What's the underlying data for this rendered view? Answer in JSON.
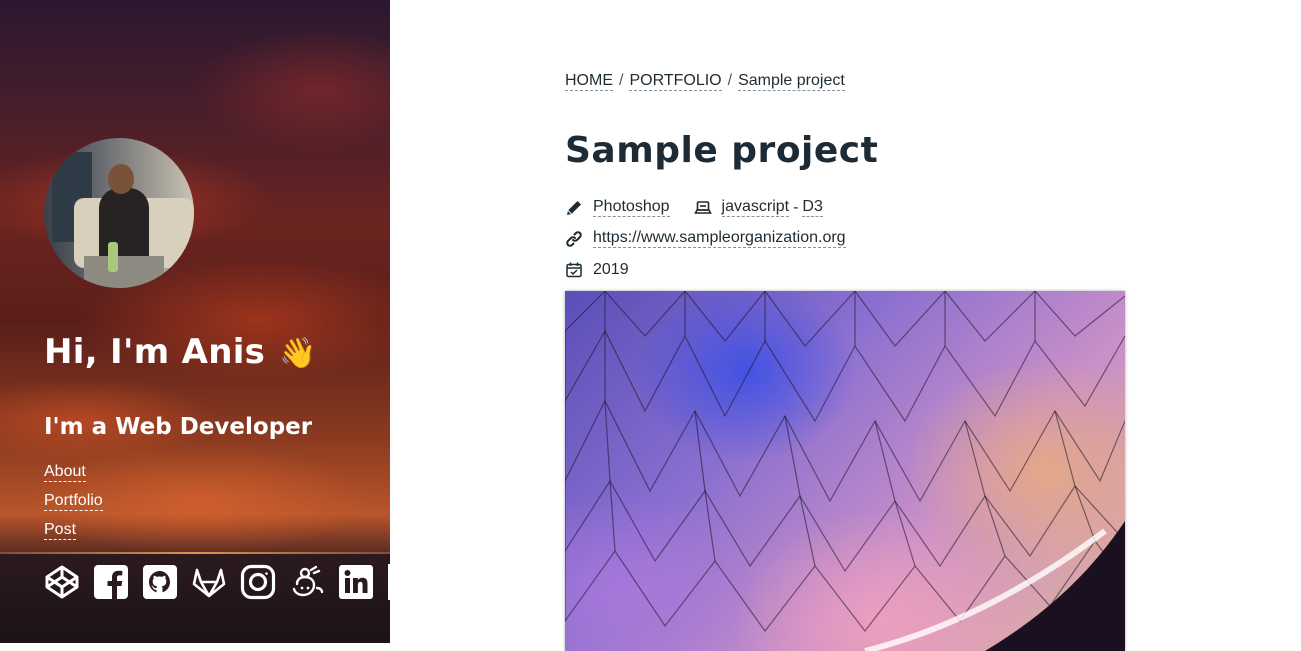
{
  "sidebar": {
    "greeting": "Hi, I'm Anis",
    "wave_emoji": "👋",
    "role": "I'm a Web Developer",
    "nav": [
      {
        "label": "About"
      },
      {
        "label": "Portfolio"
      },
      {
        "label": "Post"
      }
    ],
    "social": [
      "codepen-icon",
      "facebook-icon",
      "github-icon",
      "gitlab-icon",
      "instagram-icon",
      "keybase-icon",
      "linkedin-icon"
    ]
  },
  "breadcrumb": {
    "items": [
      {
        "label": "HOME"
      },
      {
        "label": "PORTFOLIO"
      },
      {
        "label": "Sample project"
      }
    ],
    "separator": "/"
  },
  "project": {
    "title": "Sample project",
    "tool": "Photoshop",
    "tech_1": "javascript",
    "tech_sep": "-",
    "tech_2": "D3",
    "url": "https://www.sampleorganization.org",
    "year": "2019"
  },
  "colors": {
    "text": "#1c2b35",
    "sidebar_text": "#ffffff"
  }
}
